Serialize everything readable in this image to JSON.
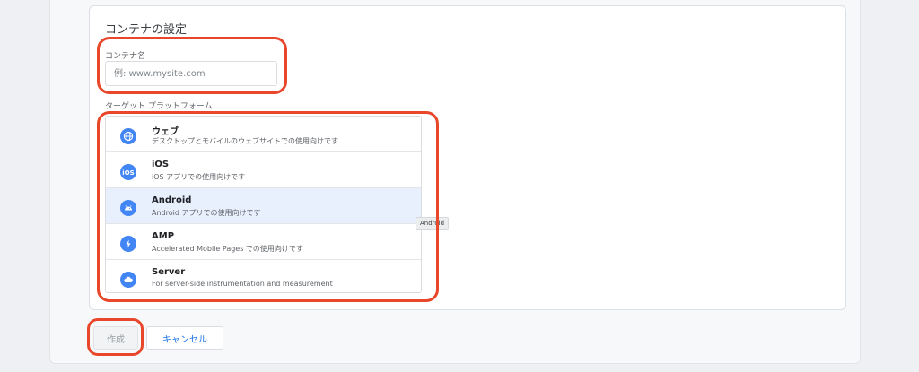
{
  "section": {
    "title": "コンテナの設定"
  },
  "container_name": {
    "label": "コンテナ名",
    "placeholder": "例: www.mysite.com",
    "value": ""
  },
  "platform": {
    "label": "ターゲット プラットフォーム",
    "items": [
      {
        "title": "ウェブ",
        "description": "デスクトップとモバイルのウェブサイトでの使用向けです",
        "icon": "globe-icon",
        "selected": false
      },
      {
        "title": "iOS",
        "description": "iOS アプリでの使用向けです",
        "icon": "ios-icon",
        "selected": false
      },
      {
        "title": "Android",
        "description": "Android アプリでの使用向けです",
        "icon": "android-icon",
        "selected": true
      },
      {
        "title": "AMP",
        "description": "Accelerated Mobile Pages での使用向けです",
        "icon": "lightning-icon",
        "selected": false
      },
      {
        "title": "Server",
        "description": "For server-side instrumentation and measurement",
        "icon": "cloud-icon",
        "selected": false
      }
    ],
    "tooltip": "Android"
  },
  "actions": {
    "create_label": "作成",
    "cancel_label": "キャンセル"
  },
  "colors": {
    "accent": "#1a73e8",
    "icon_blue": "#4285f4",
    "highlight": "#e8472b",
    "selected_row": "#e8f0fe"
  }
}
